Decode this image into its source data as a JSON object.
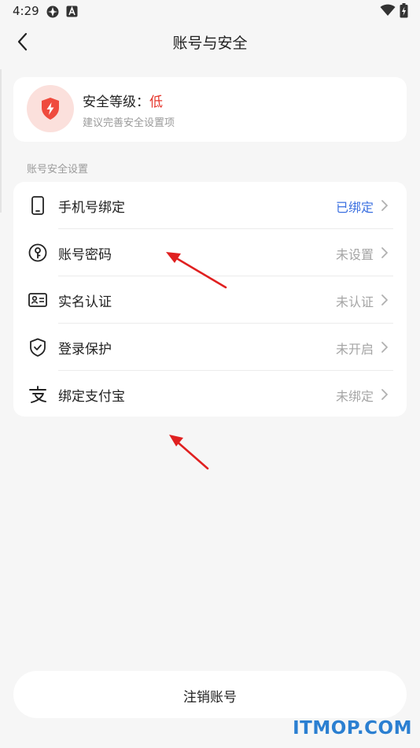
{
  "status_bar": {
    "time": "4:29"
  },
  "header": {
    "title": "账号与安全"
  },
  "security_level": {
    "label": "安全等级：",
    "value": "低",
    "tip": "建议完善安全设置项"
  },
  "section": {
    "title": "账号安全设置"
  },
  "settings": [
    {
      "label": "手机号绑定",
      "value": "已绑定",
      "icon": "phone-icon"
    },
    {
      "label": "账号密码",
      "value": "未设置",
      "icon": "key-icon"
    },
    {
      "label": "实名认证",
      "value": "未认证",
      "icon": "id-card-icon"
    },
    {
      "label": "登录保护",
      "value": "未开启",
      "icon": "shield-check-icon"
    },
    {
      "label": "绑定支付宝",
      "value": "未绑定",
      "icon": "alipay-icon"
    }
  ],
  "footer": {
    "cancel_account_label": "注销账号"
  },
  "watermark": "ITMOP.COM",
  "colors": {
    "accent_blue": "#3a6fe0",
    "danger_red": "#e5362c",
    "watermark_blue": "#2b7fd1",
    "annotation_red": "#e02020"
  }
}
